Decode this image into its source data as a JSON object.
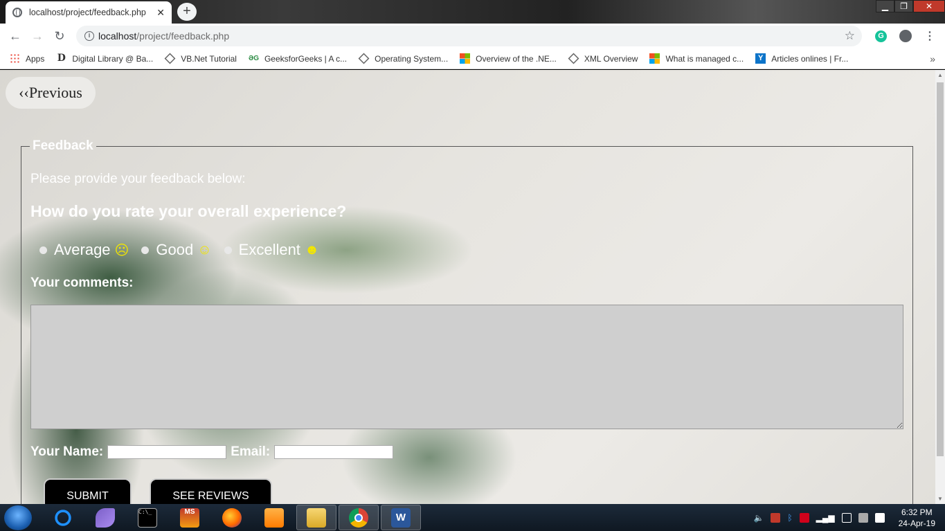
{
  "browser": {
    "tab_title": "localhost/project/feedback.php",
    "tab_close": "✕",
    "new_tab": "+",
    "url_host": "localhost",
    "url_path": "/project/feedback.php",
    "window_controls": [
      "▁",
      "❐",
      "✕"
    ]
  },
  "bookmarks": [
    {
      "label": "Apps",
      "icon": "apps-icon"
    },
    {
      "label": "Digital Library @ Ba...",
      "icon": "d-icon"
    },
    {
      "label": "VB.Net Tutorial",
      "icon": "diamond-icon"
    },
    {
      "label": "GeeksforGeeks | A c...",
      "icon": "gfg-icon"
    },
    {
      "label": "Operating System...",
      "icon": "diamond-icon"
    },
    {
      "label": "Overview of the .NE...",
      "icon": "microsoft-icon"
    },
    {
      "label": "XML Overview",
      "icon": "diamond-icon"
    },
    {
      "label": "What is managed c...",
      "icon": "microsoft-icon"
    },
    {
      "label": "Articles onlines | Fr...",
      "icon": "y-icon"
    }
  ],
  "page": {
    "previous_label": "‹‹Previous",
    "legend": "Feedback",
    "intro": "Please provide your feedback below:",
    "question": "How do you rate your overall experience?",
    "ratings": [
      {
        "label": "Average",
        "emoji": "☹"
      },
      {
        "label": "Good",
        "emoji": "☺"
      },
      {
        "label": "Excellent",
        "emoji": "☻"
      }
    ],
    "comments_label": "Your comments:",
    "comments_value": "",
    "name_label": "Your Name:",
    "name_value": "",
    "email_label": "Email:",
    "email_value": "",
    "submit_label": "SUBMIT",
    "reviews_label": "SEE REVIEWS"
  },
  "taskbar": {
    "apps": [
      "start-orb",
      "internet-explorer",
      "visual-studio",
      "command-prompt",
      "ms-project",
      "firefox",
      "media-player",
      "file-explorer",
      "chrome",
      "word"
    ],
    "time": "6:32 PM",
    "date": "24-Apr-19"
  },
  "colors": {
    "emoji": "#f2e600",
    "textarea_bg": "#cfcfcf",
    "button_bg": "#000000"
  }
}
